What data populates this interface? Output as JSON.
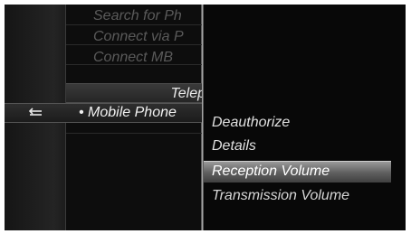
{
  "menu": {
    "items": [
      {
        "label": "Search for Ph",
        "state": "dim"
      },
      {
        "label": "Connect via P",
        "state": "dim"
      },
      {
        "label": "Connect MB",
        "state": "dim"
      }
    ],
    "header": "Telep",
    "active_item": "• Mobile Phone"
  },
  "back_icon": "back-arrow-icon",
  "submenu": {
    "items": [
      "Deauthorize",
      "Details",
      "Reception Volume",
      "Transmission Volume"
    ],
    "selected": "Reception Volume"
  },
  "colors": {
    "background": "#0b0b0b",
    "text": "#e0e0e0",
    "dim_text": "#5a5a5a",
    "highlight": "#7a7a7a"
  }
}
